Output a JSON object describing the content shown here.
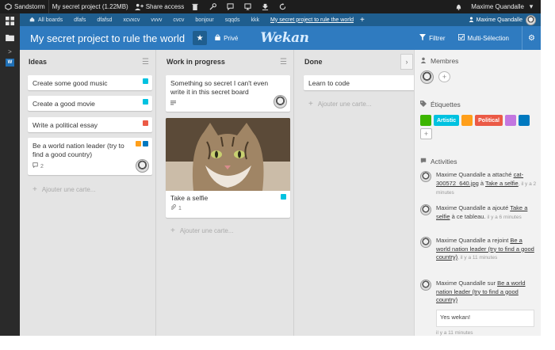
{
  "sandstorm": {
    "app_name": "Sandstorm",
    "grain_title": "My secret project (1.22MB)",
    "share_label": "Share access",
    "user_name": "Maxime Quandalle"
  },
  "breadcrumbs": {
    "items": [
      "All boards",
      "dfafs",
      "dfafsd",
      "xcvxcv",
      "vvvv",
      "cvcv",
      "bonjour",
      "sqqds",
      "kkk",
      "My secret project to rule the world"
    ],
    "add": "+",
    "user": "Maxime Quandalle"
  },
  "board": {
    "title": "My secret project to rule the world",
    "privacy": "Privé",
    "logo": "Wekan",
    "filter_label": "Filtrer",
    "multiselect_label": "Multi-Sélection"
  },
  "lists": [
    {
      "title": "Ideas",
      "cards": [
        {
          "title": "Create some good music"
        },
        {
          "title": "Create a good movie"
        },
        {
          "title": "Write a political essay"
        },
        {
          "title": "Be a world nation leader (try to find a good country)",
          "comments": "2"
        }
      ],
      "add_label": "Ajouter une carte..."
    },
    {
      "title": "Work in progress",
      "cards": [
        {
          "title": "Something so secret I can't even write it in this secret board"
        },
        {
          "title": "Take a selfie",
          "attachments": "1"
        }
      ],
      "add_label": "Ajouter une carte..."
    },
    {
      "title": "Done",
      "cards": [
        {
          "title": "Learn to code"
        }
      ],
      "add_label": "Ajouter une carte..."
    }
  ],
  "sidebar": {
    "members_title": "Membres",
    "labels_title": "Étiquettes",
    "labels": [
      {
        "name": "",
        "color": "#3cb500"
      },
      {
        "name": "Artistic",
        "color": "#00c2e0"
      },
      {
        "name": "",
        "color": "#ff9f1a"
      },
      {
        "name": "Political",
        "color": "#eb5a46"
      },
      {
        "name": "",
        "color": "#c377e0"
      },
      {
        "name": "",
        "color": "#0079bf"
      }
    ],
    "activities_title": "Activities",
    "activities": [
      {
        "user": "Maxime Quandalle",
        "action": " a attaché ",
        "object": "cat-300572_640.jpg",
        "mid": " à ",
        "target": "Take a selfie",
        "time": ", il y a 2 minutes"
      },
      {
        "user": "Maxime Quandalle",
        "action": " a ajouté ",
        "object": "Take a selfie",
        "mid": " à ce tableau.",
        "target": "",
        "time": " il y a 6 minutes"
      },
      {
        "user": "Maxime Quandalle",
        "action": " a rejoint ",
        "object": "Be a world nation leader (try to find a good country)",
        "mid": "",
        "target": "",
        "time": ", il y a 11 minutes"
      },
      {
        "user": "Maxime Quandalle",
        "action": " sur ",
        "object": "Be a world nation leader (try to find a good country)",
        "mid": "",
        "target": "",
        "time": ""
      }
    ],
    "comment_text": "Yes wekan!",
    "comment_time": "il y a 11 minutes"
  },
  "colors": {
    "header": "#2f7bc0",
    "breadcrumb": "#1f5e8f",
    "sandstorm_bar": "#1d1d1d"
  }
}
